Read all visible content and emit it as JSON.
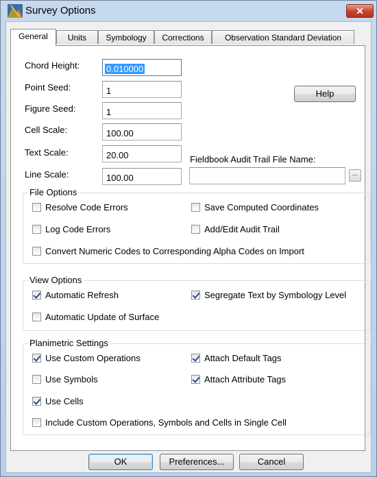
{
  "window": {
    "title": "Survey Options",
    "close_glyph": "✕"
  },
  "tabs": [
    {
      "label": "General",
      "active": true
    },
    {
      "label": "Units"
    },
    {
      "label": "Symbology"
    },
    {
      "label": "Corrections"
    },
    {
      "label": "Observation Standard Deviation"
    }
  ],
  "general": {
    "chord_height": {
      "label": "Chord Height:",
      "value": "0.010000"
    },
    "point_seed": {
      "label": "Point Seed:",
      "value": "1"
    },
    "figure_seed": {
      "label": "Figure Seed:",
      "value": "1"
    },
    "cell_scale": {
      "label": "Cell Scale:",
      "value": "100.00"
    },
    "text_scale": {
      "label": "Text Scale:",
      "value": "20.00"
    },
    "line_scale": {
      "label": "Line Scale:",
      "value": "100.00"
    },
    "help_label": "Help",
    "audit_trail": {
      "label": "Fieldbook Audit Trail File Name:",
      "value": "",
      "browse_label": "..."
    }
  },
  "file_options": {
    "title": "File Options",
    "items": [
      {
        "label": "Resolve Code Errors",
        "checked": false
      },
      {
        "label": "Save Computed Coordinates",
        "checked": false
      },
      {
        "label": "Log Code Errors",
        "checked": false
      },
      {
        "label": "Add/Edit Audit Trail",
        "checked": false
      },
      {
        "label": "Convert Numeric Codes to Corresponding Alpha Codes on Import",
        "checked": false
      }
    ]
  },
  "view_options": {
    "title": "View Options",
    "items": [
      {
        "label": "Automatic Refresh",
        "checked": true
      },
      {
        "label": "Segregate Text by Symbology Level",
        "checked": true
      },
      {
        "label": "Automatic Update of Surface",
        "checked": false
      }
    ]
  },
  "planimetric": {
    "title": "Planimetric Settings",
    "items": [
      {
        "label": "Use Custom Operations",
        "checked": true
      },
      {
        "label": "Attach Default Tags",
        "checked": true
      },
      {
        "label": "Use Symbols",
        "checked": false
      },
      {
        "label": "Attach Attribute Tags",
        "checked": true
      },
      {
        "label": "Use Cells",
        "checked": true
      },
      {
        "label": "Include Custom Operations, Symbols and Cells in Single Cell",
        "checked": false
      }
    ]
  },
  "footer": {
    "ok_label": "OK",
    "preferences_label": "Preferences...",
    "cancel_label": "Cancel"
  }
}
